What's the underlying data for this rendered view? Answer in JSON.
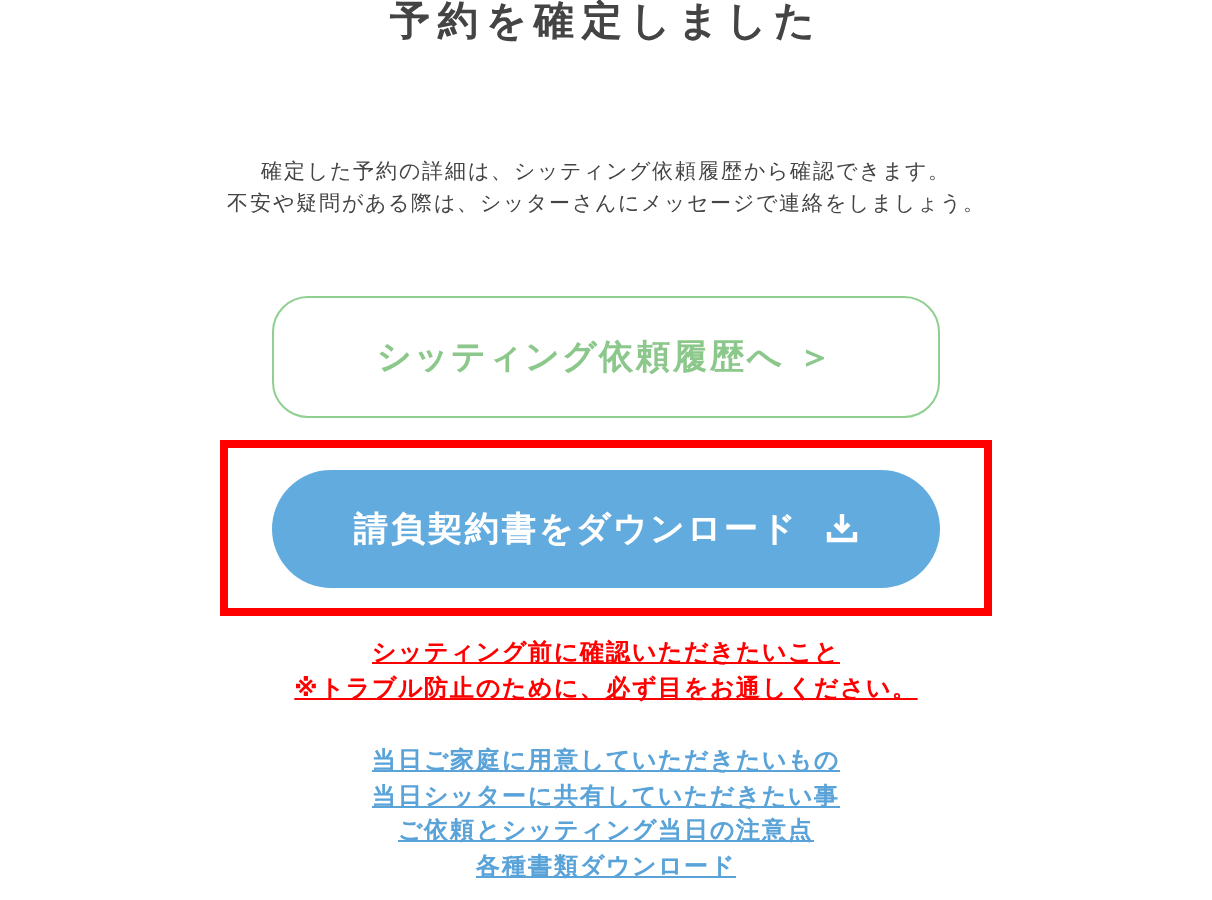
{
  "title": "予約を確定しました",
  "message": [
    "確定した予約の詳細は、シッティング依頼履歴から確認できます。",
    "不安や疑問がある際は、シッターさんにメッセージで連絡をしましょう。"
  ],
  "history_button": {
    "label": "シッティング依頼履歴へ ＞"
  },
  "download_button": {
    "label": "請負契約書をダウンロード",
    "highlighted": true
  },
  "notice_links": [
    "シッティング前に確認いただきたいこと",
    "※トラブル防止のために、必ず目をお通しください。"
  ],
  "info_links": [
    "当日ご家庭に用意していただきたいもの",
    "当日シッターに共有していただきたい事",
    "ご依頼とシッティング当日の注意点",
    "各種書類ダウンロード"
  ]
}
